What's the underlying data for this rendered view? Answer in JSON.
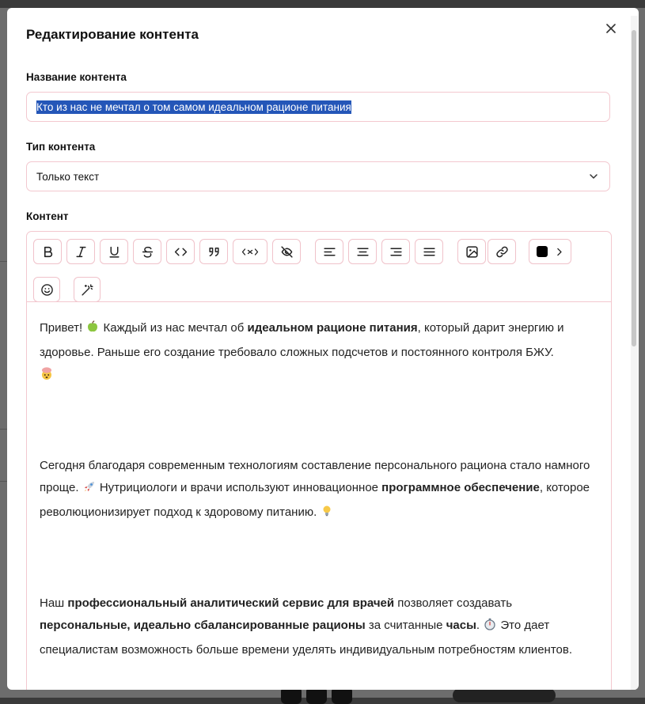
{
  "modal": {
    "title": "Редактирование контента",
    "close_label": "×"
  },
  "fields": {
    "name_label": "Название контента",
    "name_value": "Кто из нас не мечтал о том самом идеальном рационе питания",
    "type_label": "Тип контента",
    "type_value": "Только текст",
    "content_label": "Контент"
  },
  "toolbar": {
    "buttons": [
      "bold",
      "italic",
      "underline",
      "strikethrough",
      "code",
      "quote",
      "code-block",
      "hide",
      "align-left",
      "align-center",
      "align-right",
      "align-justify",
      "image",
      "link",
      "text-color",
      "emoji",
      "magic-wand"
    ]
  },
  "content": {
    "p1": {
      "a": "Привет! ",
      "b": " Каждый из нас мечтал об ",
      "bold1": "идеальном рационе питания",
      "c": ", который дарит энергию и здоровье. Раньше его создание требовало сложных подсчетов и постоянного контроля БЖУ."
    },
    "p2": {
      "a": "Сегодня благодаря современным технологиям составление персонального рациона стало намного проще. ",
      "b": " Нутрициологи и врачи используют инновационное ",
      "bold1": "программное обеспечение",
      "c": ", которое революционизирует подход к здоровому питанию. "
    },
    "p3": {
      "a": "Наш ",
      "bold1": "профессиональный аналитический сервис для врачей",
      "b": " позволяет создавать ",
      "bold2": "персональные, идеально сбалансированные рационы",
      "c": " за считанные ",
      "bold3": "часы",
      "d": ". ",
      "e": " Это дает специалистам возможность больше времени уделять индивидуальным потребностям клиентов."
    }
  },
  "colors": {
    "accent_border": "#f3c8cf",
    "selection": "#2456b8",
    "text_color_swatch": "#000000"
  }
}
